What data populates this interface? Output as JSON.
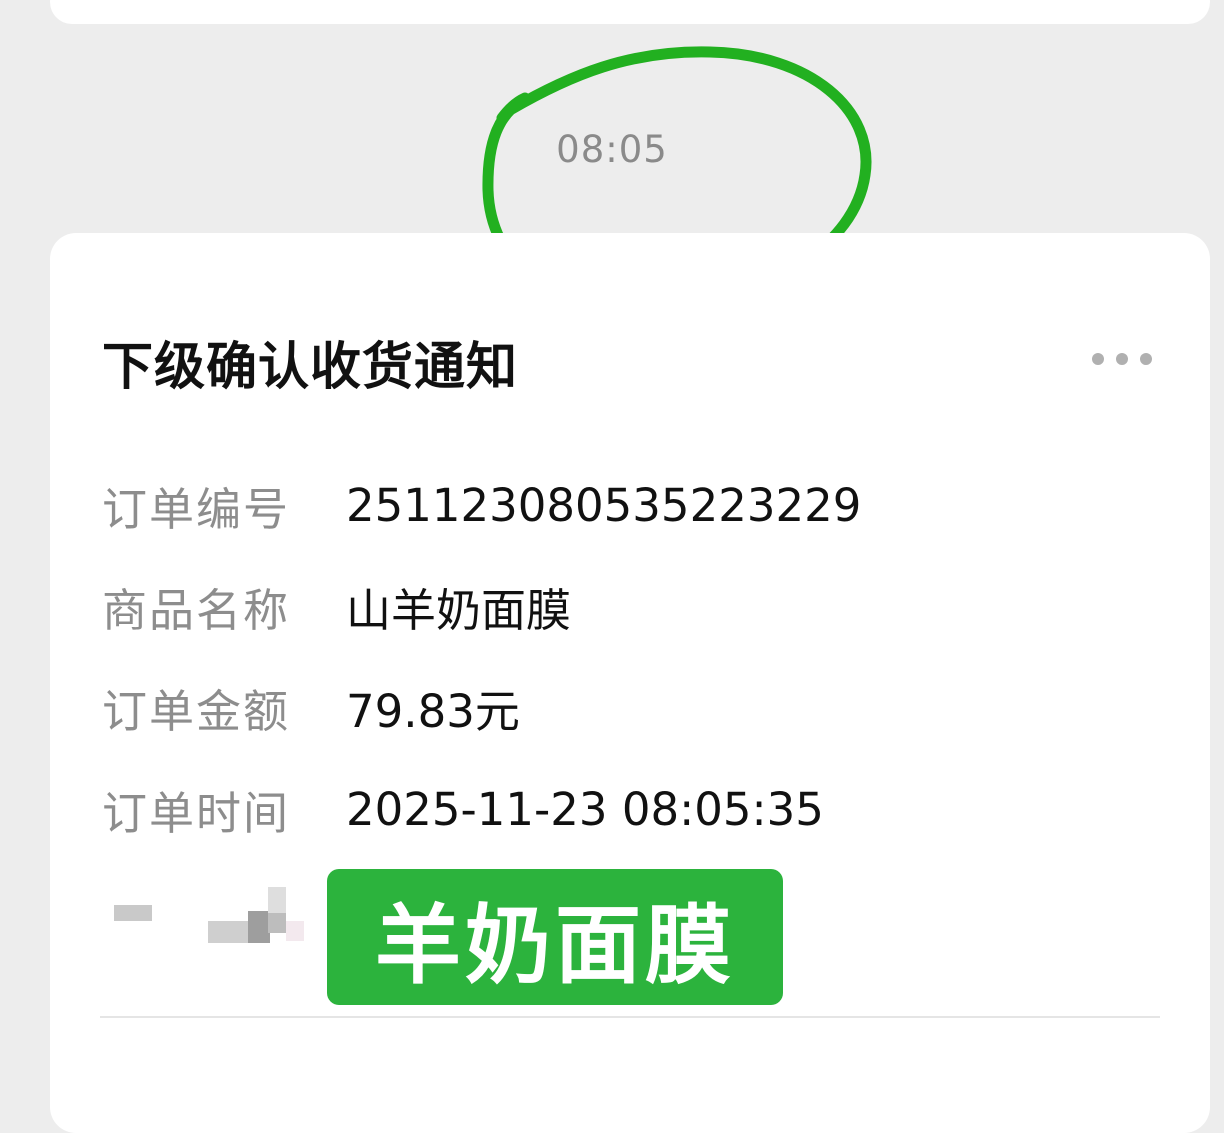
{
  "chat": {
    "timestamp": "08:05"
  },
  "notification": {
    "title": "下级确认收货通知",
    "more_icon": "more-dots-icon",
    "fields": [
      {
        "label": "订单编号",
        "value": "25112308053522322​9"
      },
      {
        "label": "商品名称",
        "value": "山羊奶面膜"
      },
      {
        "label": "订单金额",
        "value": "79.83元"
      },
      {
        "label": "订单时间",
        "value": "2025-11-23 08:05:35"
      }
    ],
    "banner_text": "羊奶面膜"
  },
  "colors": {
    "background": "#ededed",
    "card": "#ffffff",
    "annotation_circle": "#22b020",
    "banner": "#2cb33d"
  }
}
